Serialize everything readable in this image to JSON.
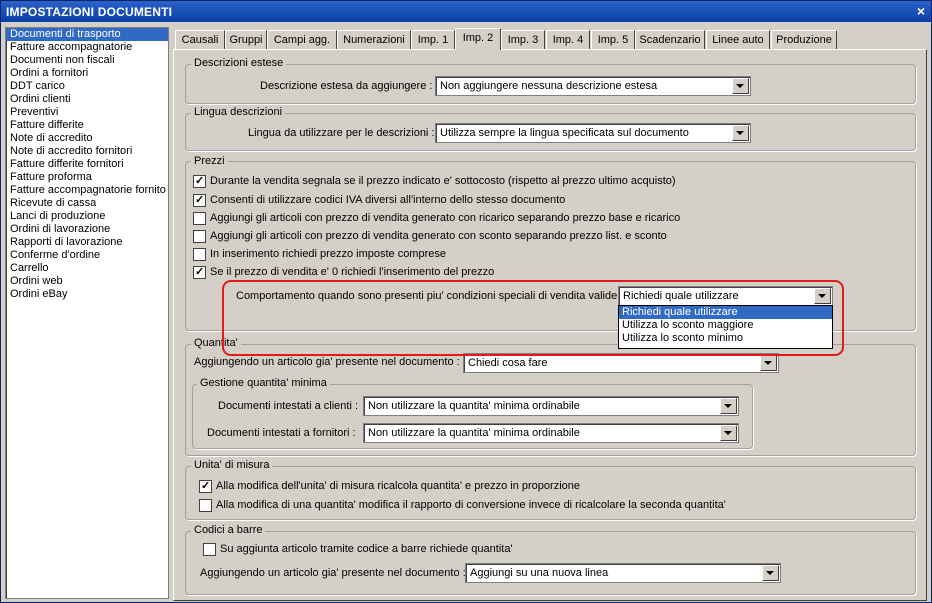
{
  "window": {
    "title": "IMPOSTAZIONI DOCUMENTI",
    "close": "×"
  },
  "list": {
    "items": [
      "Documenti di trasporto",
      "Fatture accompagnatorie",
      "Documenti non fiscali",
      "Ordini a fornitori",
      "DDT carico",
      "Ordini clienti",
      "Preventivi",
      "Fatture differite",
      "Note di accredito",
      "Note di accredito fornitori",
      "Fatture differite fornitori",
      "Fatture proforma",
      "Fatture accompagnatorie fornito",
      "Ricevute di cassa",
      "Lanci di produzione",
      "Ordini di lavorazione",
      "Rapporti di lavorazione",
      "Conferme d'ordine",
      "Carrello",
      "Ordini web",
      "Ordini eBay"
    ]
  },
  "tabs": [
    "Causali",
    "Gruppi",
    "Campi agg.",
    "Numerazioni",
    "Imp. 1",
    "Imp. 2",
    "Imp. 3",
    "Imp. 4",
    "Imp. 5",
    "Scadenzario",
    "Linee auto",
    "Produzione"
  ],
  "desc": {
    "title": "Descrizioni estese",
    "label": "Descrizione estesa da aggiungere :",
    "value": "Non aggiungere nessuna descrizione estesa"
  },
  "lingua": {
    "title": "Lingua descrizioni",
    "label": "Lingua da utilizzare per le descrizioni :",
    "value": "Utilizza sempre la lingua specificata sul documento"
  },
  "prezzi": {
    "title": "Prezzi",
    "checks": [
      {
        "text": "Durante la vendita segnala se il prezzo indicato e' sottocosto (rispetto al prezzo ultimo acquisto)",
        "mark": "✓"
      },
      {
        "text": "Consenti di utilizzare codici IVA diversi all'interno dello stesso documento",
        "mark": "✓"
      },
      {
        "text": "Aggiungi gli articoli con prezzo di vendita generato con ricarico separando prezzo base e ricarico",
        "mark": ""
      },
      {
        "text": "Aggiungi gli articoli con prezzo di vendita generato con sconto separando prezzo list. e sconto",
        "mark": ""
      },
      {
        "text": "In inserimento richiedi prezzo imposte comprese",
        "mark": ""
      },
      {
        "text": "Se il prezzo di vendita e' 0 richiedi l'inserimento del prezzo",
        "mark": "✓"
      }
    ],
    "cond_label": "Comportamento quando sono presenti piu' condizioni speciali di vendita valide :",
    "cond_value": "Richiedi quale utilizzare",
    "cond_options": [
      "Richiedi quale utilizzare",
      "Utilizza lo sconto maggiore",
      "Utilizza lo sconto minimo"
    ]
  },
  "quantita": {
    "title": "Quantita'",
    "label": "Aggiungendo un articolo gia' presente nel documento :",
    "value": "Chiedi cosa fare",
    "min_title": "Gestione quantita' minima",
    "clienti_label": "Documenti intestati a clienti :",
    "clienti_value": "Non utilizzare la quantita' minima ordinabile",
    "fornitori_label": "Documenti intestati a fornitori :",
    "fornitori_value": "Non utilizzare la quantita' minima ordinabile"
  },
  "unita": {
    "title": "Unita' di misura",
    "checks": [
      {
        "text": "Alla modifica dell'unita' di misura ricalcola quantita' e prezzo in proporzione",
        "mark": "✓"
      },
      {
        "text": "Alla modifica di una quantita' modifica il rapporto di conversione invece di ricalcolare la seconda quantita'",
        "mark": ""
      }
    ]
  },
  "barre": {
    "title": "Codici a barre",
    "check": {
      "text": "Su aggiunta articolo tramite codice a barre richiede quantita'",
      "mark": ""
    },
    "label": "Aggiungendo un articolo gia' presente nel documento :",
    "value": "Aggiungi su una nuova linea"
  }
}
